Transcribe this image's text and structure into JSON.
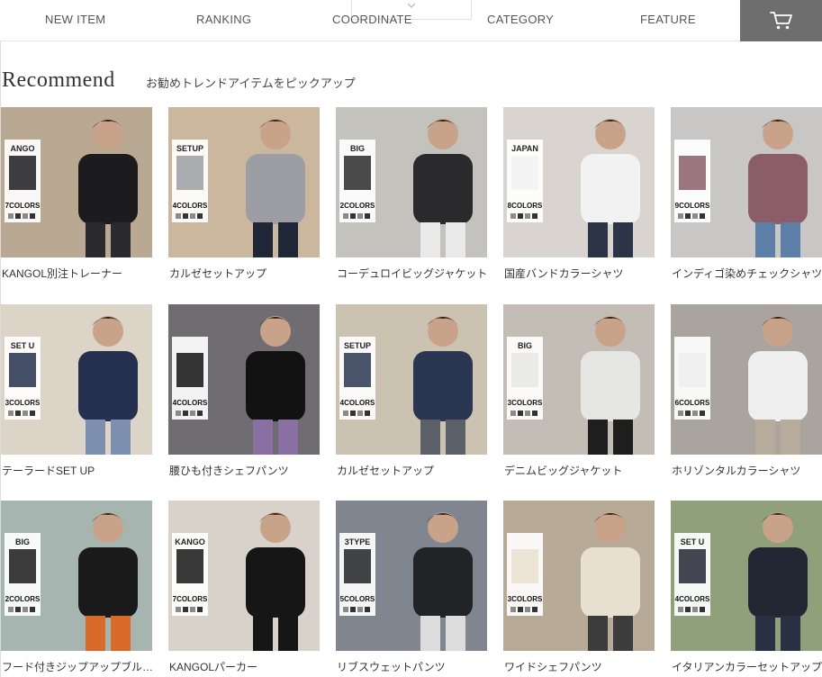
{
  "nav": {
    "items": [
      "NEW ITEM",
      "RANKING",
      "COORDINATE",
      "CATEGORY",
      "FEATURE"
    ],
    "cart_icon": "cart-icon",
    "dropdown_icon": "chevron-down-icon"
  },
  "section": {
    "title": "Recommend",
    "subtitle": "お勧めトレンドアイテムをピックアップ"
  },
  "products": [
    {
      "name": "KANGOL別注トレーナー",
      "bg": "#b9a892",
      "top": "#1c1c1e",
      "bottom": "#2a2a2e",
      "badge": "7COLORS",
      "logo": "ANGO"
    },
    {
      "name": "カルゼセットアップ",
      "bg": "#cbb79e",
      "top": "#9c9ea3",
      "bottom": "#1f2635",
      "badge": "4COLORS",
      "logo": "SETUP"
    },
    {
      "name": "コーデュロイビッグジャケット",
      "bg": "#c4c2bd",
      "top": "#2a2a2c",
      "bottom": "#eaeaea",
      "badge": "2COLORS",
      "logo": "BIG"
    },
    {
      "name": "国産バンドカラーシャツ",
      "bg": "#d9d4cf",
      "top": "#f2f2f2",
      "bottom": "#2c3447",
      "badge": "8COLORS",
      "logo": "JAPAN"
    },
    {
      "name": "インディゴ染めチェックシャツ",
      "bg": "#c9c7c6",
      "top": "#8b5e67",
      "bottom": "#5d7ea6",
      "badge": "9COLORS",
      "logo": ""
    },
    {
      "name": "テーラードSET UP",
      "bg": "#dcd4c6",
      "top": "#24304e",
      "bottom": "#7d8fb0",
      "badge": "3COLORS",
      "logo": "SET UP"
    },
    {
      "name": "腰ひも付きシェフパンツ",
      "bg": "#6f6c72",
      "top": "#121212",
      "bottom": "#8a6fa3",
      "badge": "4COLORS",
      "logo": ""
    },
    {
      "name": "カルゼセットアップ",
      "bg": "#ccc2b2",
      "top": "#2a3652",
      "bottom": "#5a5f68",
      "badge": "4COLORS",
      "logo": "SETUP"
    },
    {
      "name": "デニムビッグジャケット",
      "bg": "#c4bdb6",
      "top": "#e6e6e4",
      "bottom": "#1e1e1e",
      "badge": "3COLORS",
      "logo": "BIG"
    },
    {
      "name": "ホリゾンタルカラーシャツ",
      "bg": "#a9a59e",
      "top": "#eeeeee",
      "bottom": "#b8ad9d",
      "badge": "6COLORS",
      "logo": ""
    },
    {
      "name": "フード付きジップアップブルゾン",
      "bg": "#a7b5b0",
      "top": "#1a1a1a",
      "bottom": "#d96a2a",
      "badge": "2COLORS",
      "logo": "BIG"
    },
    {
      "name": "KANGOLパーカー",
      "bg": "#d8d2cb",
      "top": "#161616",
      "bottom": "#161616",
      "badge": "7COLORS",
      "logo": "KANGO"
    },
    {
      "name": "リブスウェットパンツ",
      "bg": "#7f8690",
      "top": "#222327",
      "bottom": "#dcdcdc",
      "badge": "5COLORS",
      "logo": "3TYPE"
    },
    {
      "name": "ワイドシェフパンツ",
      "bg": "#b7aa96",
      "top": "#e8e0cf",
      "bottom": "#3c3c3c",
      "badge": "3COLORS",
      "logo": ""
    },
    {
      "name": "イタリアンカラーセットアップ",
      "bg": "#8fa07b",
      "top": "#232733",
      "bottom": "#2a3044",
      "badge": "4COLORS",
      "logo": "SET UP"
    }
  ]
}
